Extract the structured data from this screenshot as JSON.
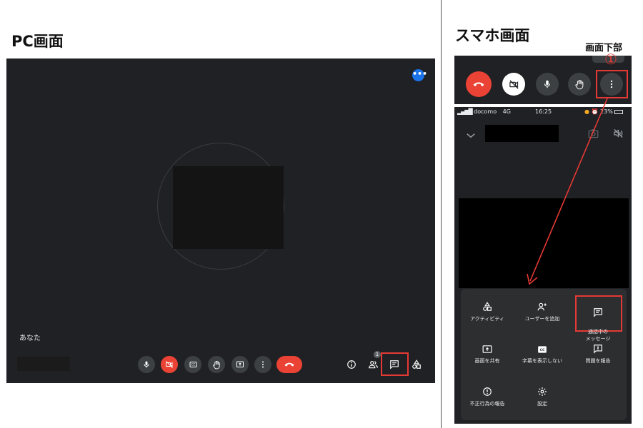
{
  "pc": {
    "heading": "PC画面",
    "self_label": "あなた",
    "participant_count": "1"
  },
  "phone": {
    "heading": "スマホ画面",
    "bottom_label": "画面下部",
    "marker": "①",
    "status": {
      "carrier": "docomo",
      "network": "4G",
      "time": "16:25",
      "battery": "23%"
    },
    "menu": [
      {
        "label": "アクティビティ",
        "icon": "activities-icon"
      },
      {
        "label": "ユーザーを追加",
        "icon": "add-person-icon"
      },
      {
        "label": "通話中の\nメッセージ",
        "icon": "chat-icon"
      },
      {
        "label": "画面を共有",
        "icon": "present-icon"
      },
      {
        "label": "字幕を表示しない",
        "icon": "captions-icon"
      },
      {
        "label": "問題を報告",
        "icon": "report-icon"
      },
      {
        "label": "不正行為の報告",
        "icon": "alert-icon"
      },
      {
        "label": "設定",
        "icon": "gear-icon"
      }
    ]
  },
  "colors": {
    "meet_bg": "#202124",
    "button_gray": "#3c4043",
    "danger_red": "#ea4335",
    "highlight_red": "#e53935",
    "accent_blue": "#1a73e8"
  }
}
